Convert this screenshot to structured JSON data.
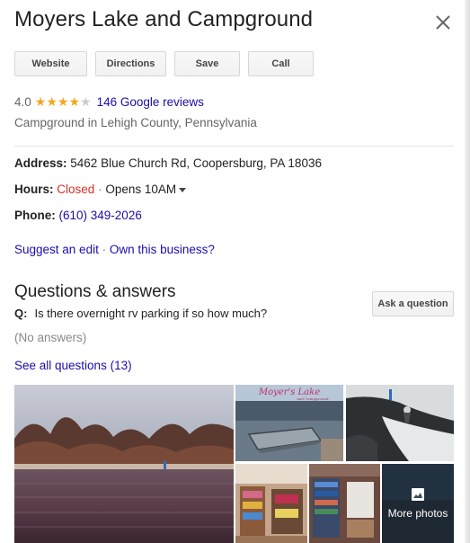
{
  "place": {
    "title": "Moyers Lake and Campground",
    "category": "Campground in Lehigh County, Pennsylvania"
  },
  "actions": {
    "website": "Website",
    "directions": "Directions",
    "save": "Save",
    "call": "Call"
  },
  "rating": {
    "value": "4.0",
    "stars": 4,
    "max_stars": 5,
    "reviews_label": "146 Google reviews"
  },
  "details": {
    "address_label": "Address:",
    "address_value": "5462 Blue Church Rd, Coopersburg, PA 18036",
    "hours_label": "Hours:",
    "hours_status": "Closed",
    "hours_separator": "·",
    "hours_next": "Opens 10AM",
    "phone_label": "Phone:",
    "phone_value": "(610) 349-2026"
  },
  "edit_links": {
    "suggest": "Suggest an edit",
    "separator": "·",
    "own": "Own this business?"
  },
  "qa": {
    "title": "Questions & answers",
    "ask_button": "Ask a question",
    "question_prefix": "Q:",
    "question_text": "Is there overnight rv parking if so how much?",
    "no_answers": "(No answers)",
    "see_all": "See all questions (13)"
  },
  "photos": {
    "sign_text": "Moyer's Lake",
    "sign_subtext": "and Campground",
    "more_label": "More photos"
  },
  "colors": {
    "star": "#f5a623",
    "link": "#1a0dab",
    "closed": "#d93025"
  }
}
